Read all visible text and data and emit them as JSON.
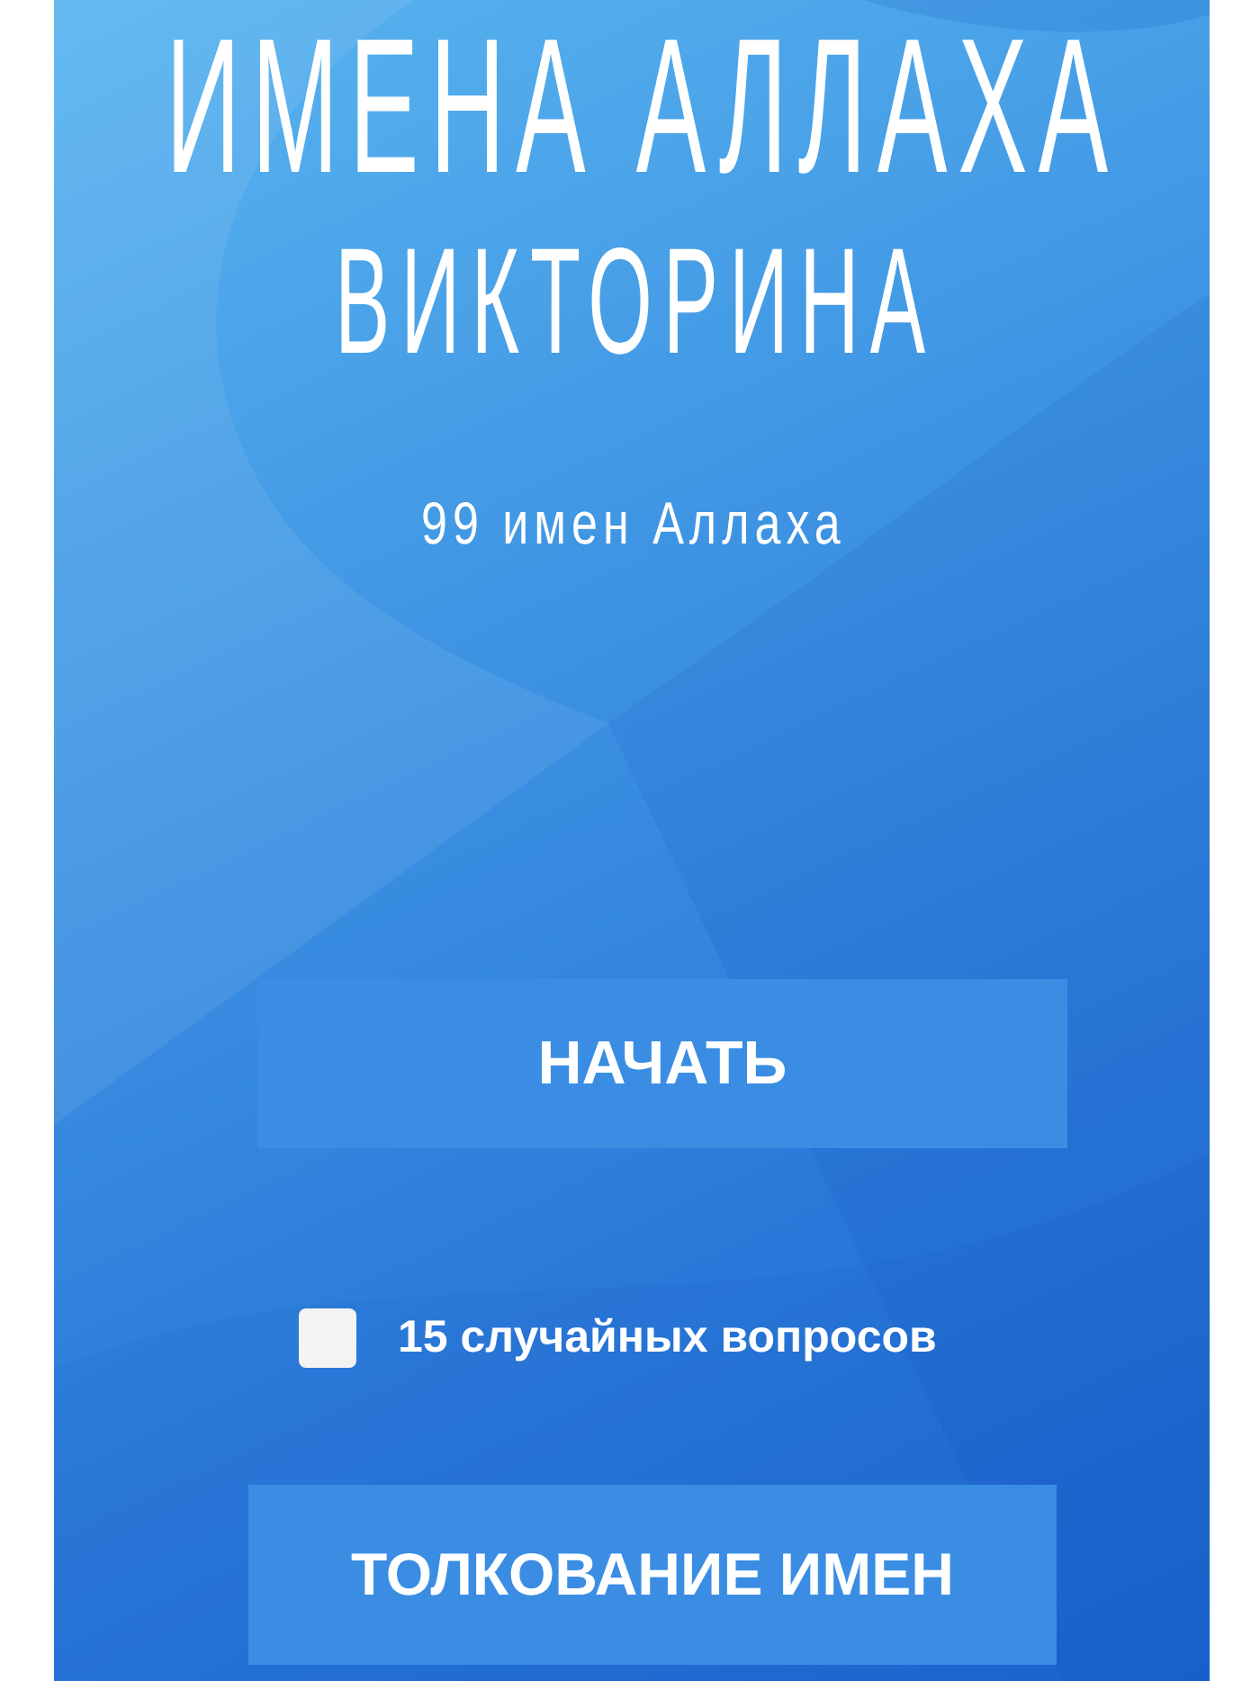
{
  "title": "ИМЕНА АЛЛАХА",
  "subtitle": "ВИКТОРИНА",
  "tagline": "99 имен Аллаха",
  "start_button": {
    "label": "НАЧАТЬ"
  },
  "random_option": {
    "label": "15 случайных вопросов",
    "checked": false
  },
  "names_button": {
    "label": "ТОЛКОВАНИЕ ИМЕН"
  }
}
